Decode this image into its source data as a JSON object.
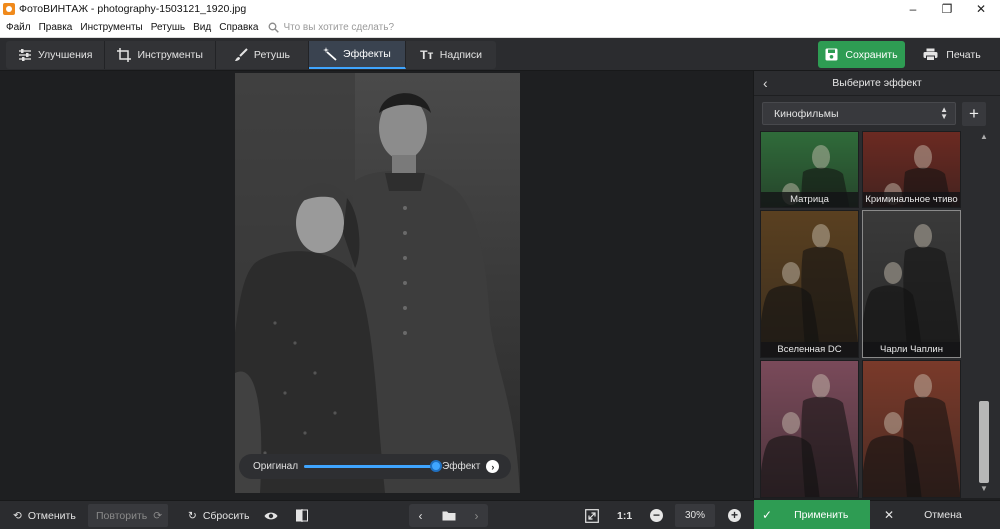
{
  "window": {
    "title": "ФотоВИНТАЖ - photography-1503121_1920.jpg",
    "minimize": "‒",
    "maximize": "❐",
    "close": "✕"
  },
  "menu": {
    "items": [
      "Файл",
      "Правка",
      "Инструменты",
      "Ретушь",
      "Вид",
      "Справка"
    ],
    "search_placeholder": "Что вы хотите сделать?"
  },
  "tabs": [
    {
      "label": "Улучшения",
      "icon": "sliders-icon"
    },
    {
      "label": "Инструменты",
      "icon": "crop-icon"
    },
    {
      "label": "Ретушь",
      "icon": "brush-icon"
    },
    {
      "label": "Эффекты",
      "icon": "magic-wand-icon",
      "active": true
    },
    {
      "label": "Надписи",
      "icon": "text-icon"
    }
  ],
  "actions": {
    "save": "Сохранить",
    "print": "Печать"
  },
  "compare": {
    "original": "Оригинал",
    "effect": "Эффект",
    "level": 1.0
  },
  "panel": {
    "title": "Выберите эффект",
    "category": "Кинофильмы",
    "effects": [
      {
        "name": "Матрица",
        "tint": "#2f6b3a"
      },
      {
        "name": "Криминальное чтиво",
        "tint": "#6b2a22"
      },
      {
        "name": "Вселенная DC",
        "tint": "#5a4020"
      },
      {
        "name": "Чарли Чаплин",
        "tint": "#3a3a3a",
        "selected": true
      },
      {
        "name": "",
        "tint": "#7a4a5a"
      },
      {
        "name": "",
        "tint": "#7a3a2a"
      }
    ]
  },
  "bottom": {
    "undo": "Отменить",
    "redo": "Повторить",
    "reset": "Сбросить",
    "ratio": "1:1",
    "zoom": "30%",
    "apply": "Применить",
    "cancel": "Отмена"
  },
  "colors": {
    "accent": "#3fa5ff",
    "green": "#2e9c53",
    "background": "#1e1f21",
    "panel": "#2b2c2f"
  }
}
